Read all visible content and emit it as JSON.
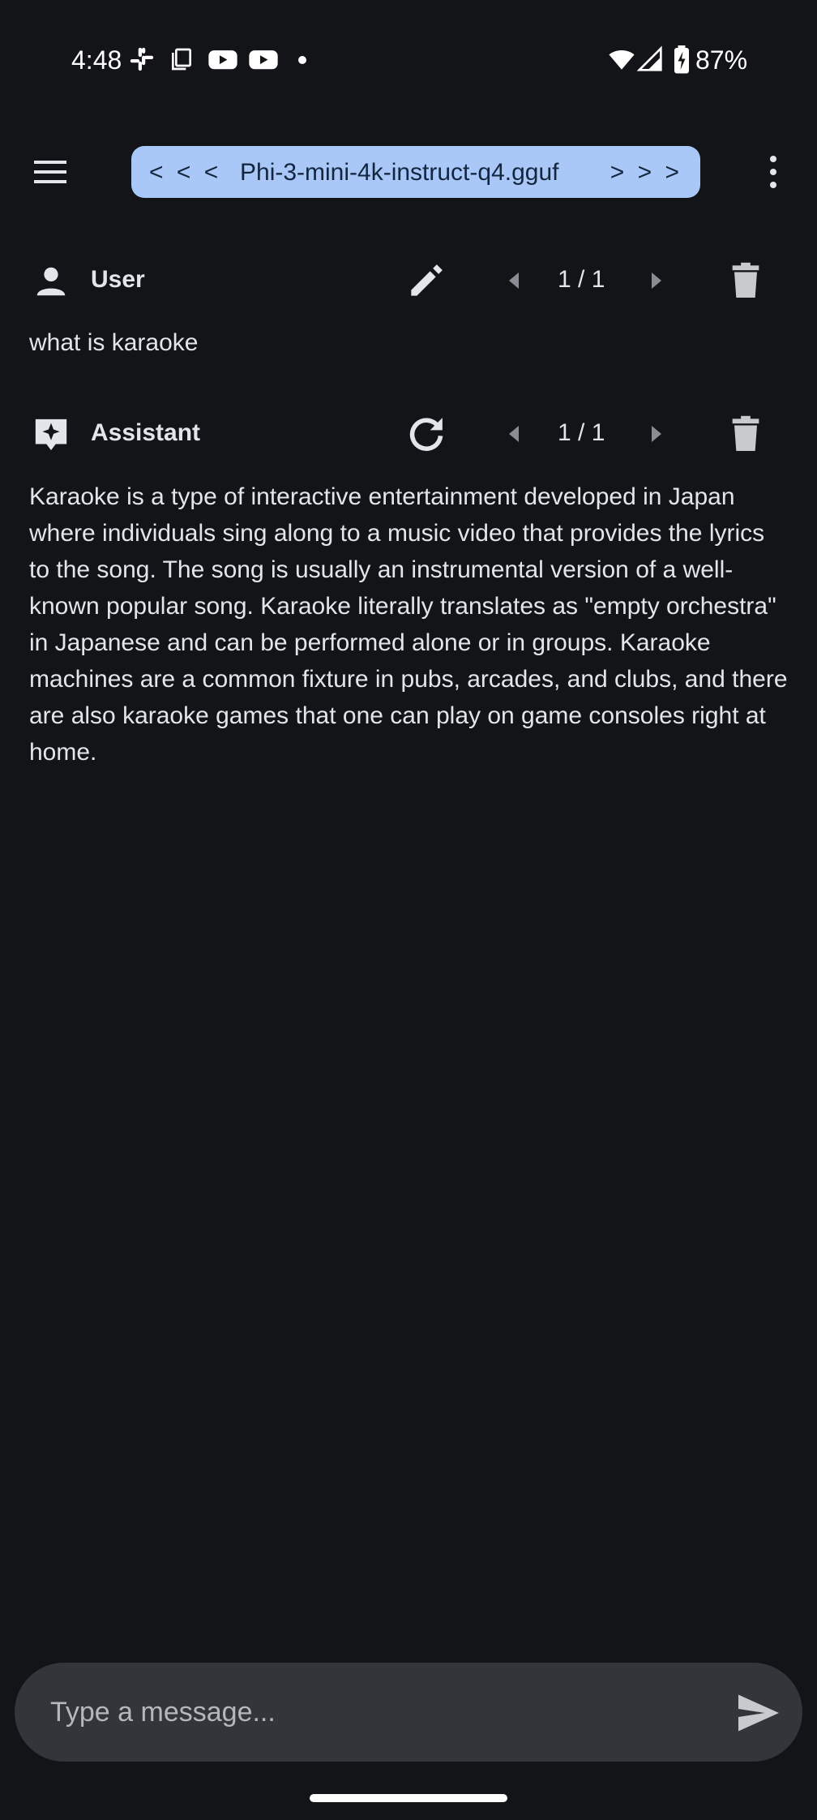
{
  "status_bar": {
    "time": "4:48",
    "battery": "87%",
    "icons": [
      "slack-icon",
      "copy-icon",
      "youtube-icon",
      "youtube-icon",
      "dot-icon",
      "wifi-icon",
      "signal-icon",
      "battery-charging-icon"
    ]
  },
  "app_bar": {
    "prev_model": "< < <",
    "model_name": "Phi-3-mini-4k-instruct-q4.gguf",
    "next_model": "> > >",
    "icons": [
      "menu-icon",
      "more-vert-icon"
    ]
  },
  "messages": [
    {
      "role": "User",
      "pager": "1 / 1",
      "text": "what is karaoke",
      "icons": [
        "person-icon",
        "edit-icon",
        "chevron-left-icon",
        "chevron-right-icon",
        "delete-icon"
      ]
    },
    {
      "role": "Assistant",
      "pager": "1 / 1",
      "text": "Karaoke is a type of interactive entertainment developed in Japan where individuals sing along to a music video that provides the lyrics to the song. The song is usually an instrumental version of a well-known popular song. Karaoke literally translates as \"empty orchestra\" in Japanese and can be performed alone or in groups. Karaoke machines are a common fixture in pubs, arcades, and clubs, and there are also karaoke games that one can play on game consoles right at home.",
      "icons": [
        "assistant-sparkle-icon",
        "regenerate-icon",
        "chevron-left-icon",
        "chevron-right-icon",
        "delete-icon"
      ]
    }
  ],
  "composer": {
    "placeholder": "Type a message...",
    "icons": [
      "send-icon"
    ]
  },
  "colors": {
    "background": "#121418",
    "pill": "#a9c7f7",
    "pill_text": "#14263f",
    "input_bg": "#33353b",
    "text": "#e4e5ea"
  }
}
